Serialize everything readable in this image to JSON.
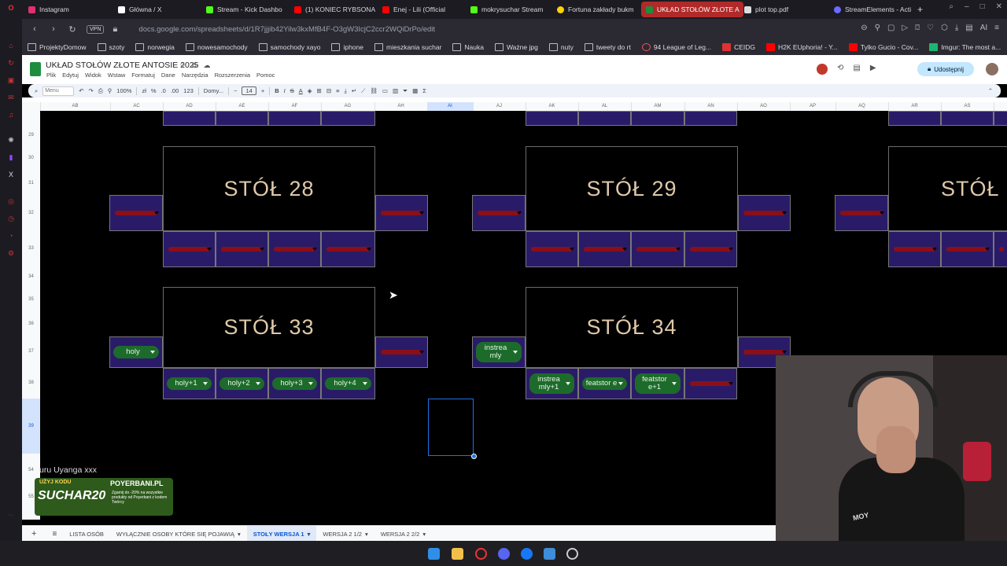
{
  "browser": {
    "tabs": [
      {
        "label": "Instagram",
        "color": "#e1306c"
      },
      {
        "label": "Główna / X",
        "color": "#ffffff"
      },
      {
        "label": "Stream - Kick Dashbo",
        "color": "#53fc18"
      },
      {
        "label": "(1) KONIEC RYBSONA",
        "color": "#ff0000"
      },
      {
        "label": "Enej - Lili (Official",
        "color": "#ff0000"
      },
      {
        "label": "mokrysuchar Stream",
        "color": "#53fc18"
      },
      {
        "label": "Fortuna zakłady bukm",
        "color": "#ffd400"
      },
      {
        "label": "UKŁAD STOŁÓW ZŁOTE A",
        "color": "#1e8e3e"
      },
      {
        "label": "plot top.pdf",
        "color": "#dddddd"
      },
      {
        "label": "StreamElements - Acti",
        "color": "#6b6bff"
      }
    ],
    "new_tab": "+",
    "vpn": "VPN",
    "url": "docs.google.com/spreadsheets/d/1R7jjjib42Yilw3kxMfB4F-O3gW3IcjC2ccr2WQiDrPo/edit",
    "ai_label": "AI",
    "bookmarks": [
      "ProjektyDomow",
      "szoty",
      "norwegia",
      "nowesamochody",
      "samochody xayo",
      "iphone",
      "mieszkania suchar",
      "Nauka",
      "Ważne jpg",
      "nuty",
      "tweety do rt",
      "94 League of Leg...",
      "CEIDG",
      "H2K EUphoria! - Y...",
      "Tylko Gucio - Cov...",
      "Imgur: The most a..."
    ]
  },
  "sheets": {
    "doc_title": "UKŁAD STOŁÓW ZŁOTE ANTOSIE 2025",
    "menus": [
      "Plik",
      "Edytuj",
      "Widok",
      "Wstaw",
      "Formatuj",
      "Dane",
      "Narzędzia",
      "Rozszerzenia",
      "Pomoc"
    ],
    "share_label": "Udostępnij",
    "toolbar": {
      "search_placeholder": "Menu",
      "zoom": "100%",
      "font": "Domy...",
      "font_size": "14",
      "format_123": "123"
    },
    "columns": [
      "AB",
      "AC",
      "AD",
      "AE",
      "AF",
      "AG",
      "AH",
      "AI",
      "AJ",
      "AK",
      "AL",
      "AM",
      "AN",
      "AO",
      "AP",
      "AQ",
      "AR",
      "AS"
    ],
    "rows": [
      "29",
      "30",
      "31",
      "32",
      "33",
      "34",
      "35",
      "36",
      "37",
      "38",
      "39",
      "54",
      "55"
    ],
    "tables": [
      {
        "label": "STÓŁ 28"
      },
      {
        "label": "STÓŁ 29"
      },
      {
        "label": "STÓŁ"
      },
      {
        "label": "STÓŁ 33"
      },
      {
        "label": "STÓŁ 34"
      }
    ],
    "chips": {
      "t33_left": "holy",
      "t33_b1": "holy+1",
      "t33_b2": "holy+2",
      "t33_b3": "holy+3",
      "t33_b4": "holy+4",
      "t34_left": "instrea mly",
      "t34_b1": "instrea mly+1",
      "t34_b2": "featstor e",
      "t34_b3": "featstor e+1"
    },
    "sheet_tabs": [
      {
        "label": "LISTA OSÓB"
      },
      {
        "label": "WYŁĄCZNIE OSOBY KTÓRE SIĘ POJAWIĄ"
      },
      {
        "label": "STOŁY WERSJA 1"
      },
      {
        "label": "WERSJA 2 1/2"
      },
      {
        "label": "WERSJA 2 2/2"
      }
    ]
  },
  "overlay": {
    "chat_text": "uru    Uyanga xxx",
    "promo_top": "UŻYJ KODU",
    "promo_code": "SUCHAR20",
    "promo_brand": "POYERBANI.PL",
    "promo_desc": "Zgarnij do -20% na wszystkie produkty od Poyerbani z kodem Twórcy",
    "shirt_brand": "MOY"
  }
}
